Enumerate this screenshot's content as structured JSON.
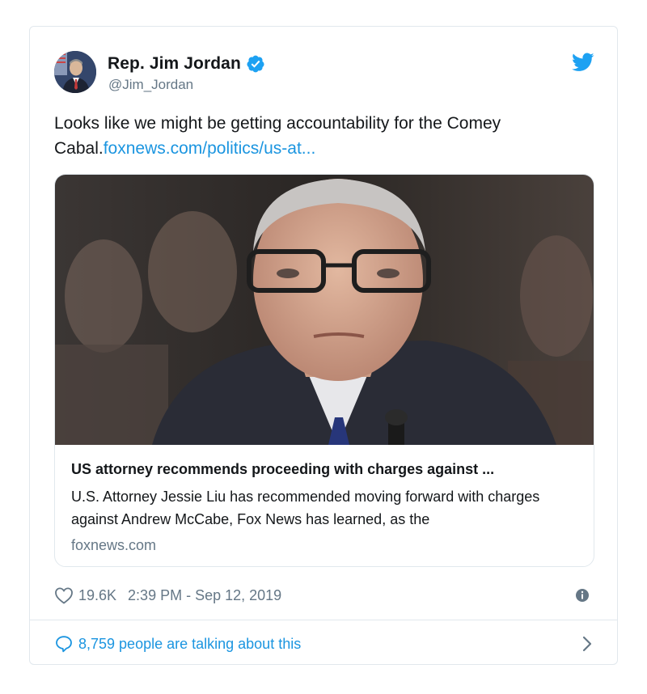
{
  "author": {
    "name": "Rep. Jim Jordan",
    "handle": "@Jim_Jordan",
    "verified": true
  },
  "tweet": {
    "text": "Looks like we might be getting accountability for the Comey Cabal.",
    "link": "foxnews.com/politics/us-at..."
  },
  "card": {
    "title": "US attorney recommends proceeding with charges against ...",
    "description": "U.S. Attorney Jessie Liu has recommended moving forward with charges against Andrew McCabe, Fox News has learned, as the",
    "domain": "foxnews.com"
  },
  "footer": {
    "likes": "19.6K",
    "timestamp": "2:39 PM - Sep 12, 2019",
    "talking": "8,759 people are talking about this"
  },
  "icons": {
    "bird": "twitter-bird-icon",
    "verified": "verified-badge-icon",
    "heart": "heart-icon",
    "info": "info-icon",
    "bubble": "reply-bubble-icon",
    "chevron": "chevron-right-icon"
  },
  "colors": {
    "accent": "#1da1f2",
    "link": "#1b95e0",
    "muted": "#657786",
    "text": "#14171a",
    "border": "#e1e8ed"
  }
}
